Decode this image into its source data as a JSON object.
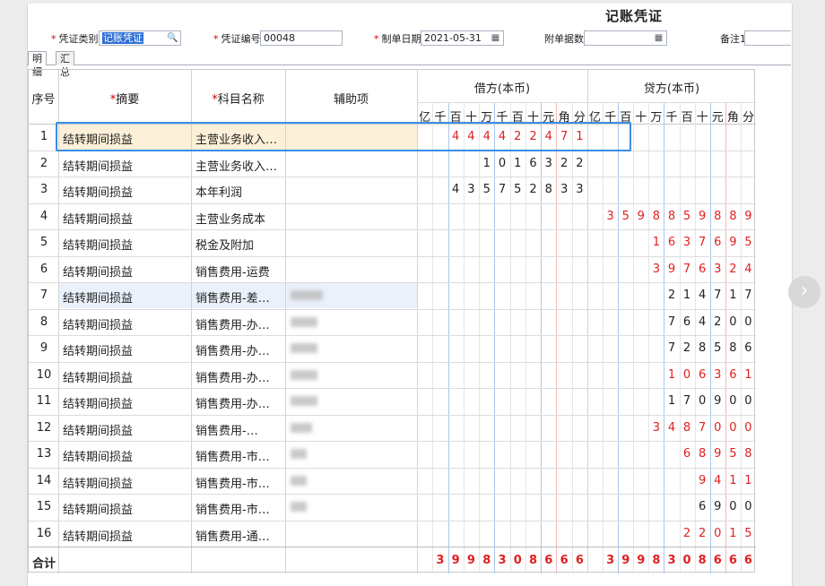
{
  "voucher": {
    "title": "记账凭证",
    "type_label": "凭证类别",
    "type_value": "记账凭证",
    "number_label": "凭证编号",
    "number_value": "00048",
    "date_label": "制单日期",
    "date_value": "2021-05-31",
    "attach_label": "附单据数",
    "attach_value": "",
    "remark_label": "备注1",
    "remark_value": ""
  },
  "tabs": [
    "明细",
    "汇总"
  ],
  "columns": {
    "seq": "序号",
    "summary": "摘要",
    "subject": "科目名称",
    "aux": "辅助项",
    "debit": "借方(本币)",
    "credit": "贷方(本币)",
    "units": [
      "亿",
      "千",
      "百",
      "十",
      "万",
      "千",
      "百",
      "十",
      "元",
      "角",
      "分"
    ]
  },
  "rows": [
    {
      "no": "1",
      "summary": "结转期间损益",
      "subject": "主营业务收入…",
      "debit": "444422471",
      "credit": "",
      "red_debit": true,
      "red_credit": false
    },
    {
      "no": "2",
      "summary": "结转期间损益",
      "subject": "主营业务收入…",
      "debit": "1016322",
      "credit": "",
      "red_debit": false,
      "red_credit": false
    },
    {
      "no": "3",
      "summary": "结转期间损益",
      "subject": "本年利润",
      "debit": "435752833",
      "credit": "",
      "red_debit": false,
      "red_credit": false
    },
    {
      "no": "4",
      "summary": "结转期间损益",
      "subject": "主营业务成本",
      "debit": "",
      "credit": "3598859889",
      "red_debit": false,
      "red_credit": true
    },
    {
      "no": "5",
      "summary": "结转期间损益",
      "subject": "税金及附加",
      "debit": "",
      "credit": "1637695",
      "red_debit": false,
      "red_credit": true
    },
    {
      "no": "6",
      "summary": "结转期间损益",
      "subject": "销售费用-运费",
      "debit": "",
      "credit": "3976324",
      "red_debit": false,
      "red_credit": true
    },
    {
      "no": "7",
      "summary": "结转期间损益",
      "subject": "销售费用-差…",
      "debit": "",
      "credit": "214717",
      "red_debit": false,
      "red_credit": false
    },
    {
      "no": "8",
      "summary": "结转期间损益",
      "subject": "销售费用-办…",
      "debit": "",
      "credit": "764200",
      "red_debit": false,
      "red_credit": false
    },
    {
      "no": "9",
      "summary": "结转期间损益",
      "subject": "销售费用-办…",
      "debit": "",
      "credit": "728586",
      "red_debit": false,
      "red_credit": false
    },
    {
      "no": "10",
      "summary": "结转期间损益",
      "subject": "销售费用-办…",
      "debit": "",
      "credit": "106361",
      "red_debit": false,
      "red_credit": true
    },
    {
      "no": "11",
      "summary": "结转期间损益",
      "subject": "销售费用-办…",
      "debit": "",
      "credit": "170900",
      "red_debit": false,
      "red_credit": false
    },
    {
      "no": "12",
      "summary": "结转期间损益",
      "subject": "销售费用-…",
      "debit": "",
      "credit": "3487000",
      "red_debit": false,
      "red_credit": true
    },
    {
      "no": "13",
      "summary": "结转期间损益",
      "subject": "销售费用-市…",
      "debit": "",
      "credit": "68958",
      "red_debit": false,
      "red_credit": true
    },
    {
      "no": "14",
      "summary": "结转期间损益",
      "subject": "销售费用-市…",
      "debit": "",
      "credit": "9411",
      "red_debit": false,
      "red_credit": true
    },
    {
      "no": "15",
      "summary": "结转期间损益",
      "subject": "销售费用-市…",
      "debit": "",
      "credit": "6900",
      "red_debit": false,
      "red_credit": false
    },
    {
      "no": "16",
      "summary": "结转期间损益",
      "subject": "销售费用-通…",
      "debit": "",
      "credit": "22015",
      "red_debit": false,
      "red_credit": true
    }
  ],
  "totals": {
    "label": "合计",
    "debit": "3998308666",
    "credit": "3998308666"
  }
}
